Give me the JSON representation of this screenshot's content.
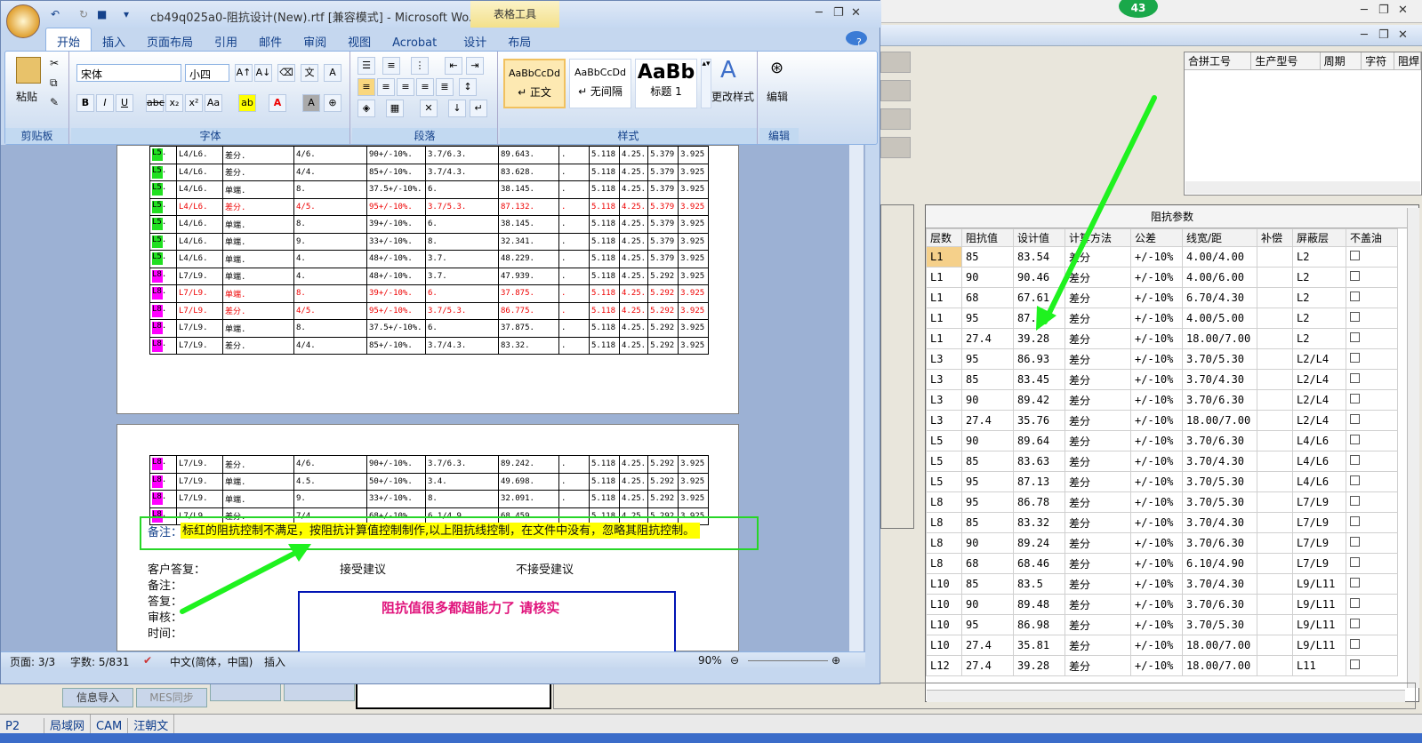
{
  "background_app": {
    "badge": "43",
    "top_grid": {
      "headers": [
        "合拼工号",
        "生产型号",
        "周期",
        "字符",
        "阻焊"
      ]
    },
    "impedance_panel": {
      "caption": "阻抗参数",
      "headers": [
        "层数",
        "阻抗值",
        "设计值",
        "计算方法",
        "公差",
        "线宽/距",
        "补偿",
        "屏蔽层",
        "不盖油"
      ],
      "rows": [
        [
          "L1",
          "85",
          "83.54",
          "差分",
          "+/-10%",
          "4.00/4.00",
          "",
          "L2"
        ],
        [
          "L1",
          "90",
          "90.46",
          "差分",
          "+/-10%",
          "4.00/6.00",
          "",
          "L2"
        ],
        [
          "L1",
          "68",
          "67.61",
          "差分",
          "+/-10%",
          "6.70/4.30",
          "",
          "L2"
        ],
        [
          "L1",
          "95",
          "87.56",
          "差分",
          "+/-10%",
          "4.00/5.00",
          "",
          "L2"
        ],
        [
          "L1",
          "27.4",
          "39.28",
          "差分",
          "+/-10%",
          "18.00/7.00",
          "",
          "L2"
        ],
        [
          "L3",
          "95",
          "86.93",
          "差分",
          "+/-10%",
          "3.70/5.30",
          "",
          "L2/L4"
        ],
        [
          "L3",
          "85",
          "83.45",
          "差分",
          "+/-10%",
          "3.70/4.30",
          "",
          "L2/L4"
        ],
        [
          "L3",
          "90",
          "89.42",
          "差分",
          "+/-10%",
          "3.70/6.30",
          "",
          "L2/L4"
        ],
        [
          "L3",
          "27.4",
          "35.76",
          "差分",
          "+/-10%",
          "18.00/7.00",
          "",
          "L2/L4"
        ],
        [
          "L5",
          "90",
          "89.64",
          "差分",
          "+/-10%",
          "3.70/6.30",
          "",
          "L4/L6"
        ],
        [
          "L5",
          "85",
          "83.63",
          "差分",
          "+/-10%",
          "3.70/4.30",
          "",
          "L4/L6"
        ],
        [
          "L5",
          "95",
          "87.13",
          "差分",
          "+/-10%",
          "3.70/5.30",
          "",
          "L4/L6"
        ],
        [
          "L8",
          "95",
          "86.78",
          "差分",
          "+/-10%",
          "3.70/5.30",
          "",
          "L7/L9"
        ],
        [
          "L8",
          "85",
          "83.32",
          "差分",
          "+/-10%",
          "3.70/4.30",
          "",
          "L7/L9"
        ],
        [
          "L8",
          "90",
          "89.24",
          "差分",
          "+/-10%",
          "3.70/6.30",
          "",
          "L7/L9"
        ],
        [
          "L8",
          "68",
          "68.46",
          "差分",
          "+/-10%",
          "6.10/4.90",
          "",
          "L7/L9"
        ],
        [
          "L10",
          "85",
          "83.5",
          "差分",
          "+/-10%",
          "3.70/4.30",
          "",
          "L9/L11"
        ],
        [
          "L10",
          "90",
          "89.48",
          "差分",
          "+/-10%",
          "3.70/6.30",
          "",
          "L9/L11"
        ],
        [
          "L10",
          "95",
          "86.98",
          "差分",
          "+/-10%",
          "3.70/5.30",
          "",
          "L9/L11"
        ],
        [
          "L10",
          "27.4",
          "35.81",
          "差分",
          "+/-10%",
          "18.00/7.00",
          "",
          "L9/L11"
        ],
        [
          "L12",
          "27.4",
          "39.28",
          "差分",
          "+/-10%",
          "18.00/7.00",
          "",
          "L11"
        ]
      ]
    },
    "buttons": [
      "信息导入",
      "MES同步"
    ],
    "bottom_tabs": [
      "P2",
      "局域网",
      "CAM",
      "汪朝文"
    ]
  },
  "word": {
    "title": "cb49q025a0-阻抗设计(New).rtf [兼容模式] - Microsoft Wo...",
    "context_tab": "表格工具",
    "tabs": [
      "开始",
      "插入",
      "页面布局",
      "引用",
      "邮件",
      "审阅",
      "视图",
      "Acrobat",
      "设计",
      "布局"
    ],
    "font_name": "宋体",
    "font_size": "小四",
    "paste_label": "粘贴",
    "groups": [
      "剪贴板",
      "字体",
      "段落",
      "样式",
      "编辑"
    ],
    "styles": [
      {
        "preview": "AaBbCcDd",
        "name": "↵ 正文"
      },
      {
        "preview": "AaBbCcDd",
        "name": "↵ 无间隔"
      },
      {
        "preview": "AaBb",
        "name": "标题 1"
      }
    ],
    "change_style": "更改样式",
    "edit_label": "编辑",
    "page1_rows": [
      {
        "c": "g",
        "l": "L5.",
        "a": "L4/L6.",
        "b": "差分.",
        "d": "4/6.",
        "e": "90+/-10%.",
        "f": "3.7/6.3.",
        "v": "89.643.",
        "r": false
      },
      {
        "c": "g",
        "l": "L5.",
        "a": "L4/L6.",
        "b": "差分.",
        "d": "4/4.",
        "e": "85+/-10%.",
        "f": "3.7/4.3.",
        "v": "83.628.",
        "r": false
      },
      {
        "c": "g",
        "l": "L5.",
        "a": "L4/L6.",
        "b": "单端.",
        "d": "8.",
        "e": "37.5+/-10%.",
        "f": "6.",
        "v": "38.145.",
        "r": false
      },
      {
        "c": "g",
        "l": "L5.",
        "a": "L4/L6.",
        "b": "差分.",
        "d": "4/5.",
        "e": "95+/-10%.",
        "f": "3.7/5.3.",
        "v": "87.132.",
        "r": true
      },
      {
        "c": "g",
        "l": "L5.",
        "a": "L4/L6.",
        "b": "单端.",
        "d": "8.",
        "e": "39+/-10%.",
        "f": "6.",
        "v": "38.145.",
        "r": false
      },
      {
        "c": "g",
        "l": "L5.",
        "a": "L4/L6.",
        "b": "单端.",
        "d": "9.",
        "e": "33+/-10%.",
        "f": "8.",
        "v": "32.341.",
        "r": false
      },
      {
        "c": "g",
        "l": "L5.",
        "a": "L4/L6.",
        "b": "单端.",
        "d": "4.",
        "e": "48+/-10%.",
        "f": "3.7.",
        "v": "48.229.",
        "r": false
      },
      {
        "c": "m",
        "l": "L8.",
        "a": "L7/L9.",
        "b": "单端.",
        "d": "4.",
        "e": "48+/-10%.",
        "f": "3.7.",
        "v": "47.939.",
        "r": false
      },
      {
        "c": "m",
        "l": "L8.",
        "a": "L7/L9.",
        "b": "单端.",
        "d": "8.",
        "e": "39+/-10%.",
        "f": "6.",
        "v": "37.875.",
        "r": true
      },
      {
        "c": "m",
        "l": "L8.",
        "a": "L7/L9.",
        "b": "差分.",
        "d": "4/5.",
        "e": "95+/-10%.",
        "f": "3.7/5.3.",
        "v": "86.775.",
        "r": true
      },
      {
        "c": "m",
        "l": "L8.",
        "a": "L7/L9.",
        "b": "单端.",
        "d": "8.",
        "e": "37.5+/-10%.",
        "f": "6.",
        "v": "37.875.",
        "r": false
      },
      {
        "c": "m",
        "l": "L8.",
        "a": "L7/L9.",
        "b": "差分.",
        "d": "4/4.",
        "e": "85+/-10%.",
        "f": "3.7/4.3.",
        "v": "83.32.",
        "r": false
      }
    ],
    "page1_tail": {
      "p": "5.118",
      "q": "4.25."
    },
    "page2_rows": [
      {
        "c": "m",
        "l": "L8.",
        "a": "L7/L9.",
        "b": "差分.",
        "d": "4/6.",
        "e": "90+/-10%.",
        "f": "3.7/6.3.",
        "v": "89.242.",
        "r": false
      },
      {
        "c": "m",
        "l": "L8.",
        "a": "L7/L9.",
        "b": "单端.",
        "d": "4.5.",
        "e": "50+/-10%.",
        "f": "3.4.",
        "v": "49.698.",
        "r": false
      },
      {
        "c": "m",
        "l": "L8.",
        "a": "L7/L9.",
        "b": "单端.",
        "d": "9.",
        "e": "33+/-10%.",
        "f": "8.",
        "v": "32.091.",
        "r": false
      },
      {
        "c": "m",
        "l": "L8.",
        "a": "L7/L9.",
        "b": "差分.",
        "d": "7/4.",
        "e": "68+/-10%.",
        "f": "6.1/4.9.",
        "v": "68.459.",
        "r": false
      }
    ],
    "remark_label": "备注：",
    "remark_text": "标红的阻抗控制不满足，按阻抗计算值控制制作,以上阻抗线控制，在文件中没有，忽略其阻抗控制。",
    "customer_reply": "客户答复：",
    "accept": "接受建议",
    "reject": "不接受建议",
    "note": "备注：",
    "answer": "答复：",
    "review": "审核：",
    "time": "时间：",
    "callout": "阻抗值很多都超能力了    请核实",
    "status": {
      "page": "页面: 3/3",
      "words": "字数: 5/831",
      "lang": "中文(简体，中国)",
      "mode": "插入",
      "zoom": "90%"
    }
  }
}
